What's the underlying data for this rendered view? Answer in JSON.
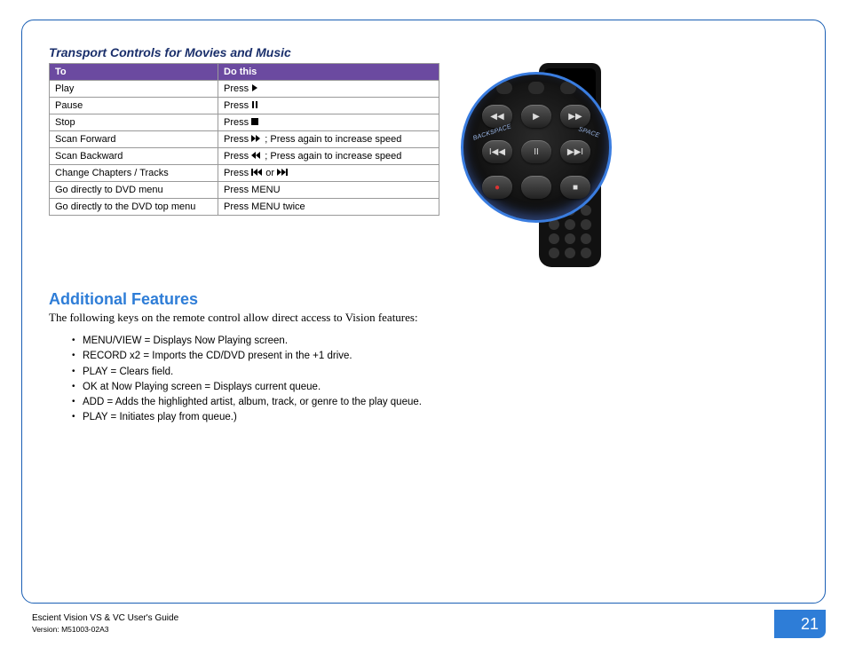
{
  "section_title": "Transport Controls for Movies and Music",
  "table": {
    "headers": {
      "to": "To",
      "do": "Do this"
    },
    "rows": [
      {
        "to": "Play",
        "do_pre": "Press ",
        "icon": "play",
        "do_post": ""
      },
      {
        "to": "Pause",
        "do_pre": "Press ",
        "icon": "pause",
        "do_post": ""
      },
      {
        "to": "Stop",
        "do_pre": "Press ",
        "icon": "stop",
        "do_post": ""
      },
      {
        "to": "Scan Forward",
        "do_pre": "Press ",
        "icon": "ff",
        "do_post": " ; Press again to increase speed"
      },
      {
        "to": "Scan Backward",
        "do_pre": "Press ",
        "icon": "rw",
        "do_post": " ; Press again to increase speed"
      },
      {
        "to": "Change Chapters / Tracks",
        "do_pre": "Press ",
        "icon": "skipb",
        "do_mid": "  or ",
        "icon2": "skipf",
        "do_post": ""
      },
      {
        "to": "Go directly to DVD menu",
        "do_pre": "Press MENU",
        "icon": "",
        "do_post": ""
      },
      {
        "to": "Go directly to the DVD top menu",
        "do_pre": "Press MENU twice",
        "icon": "",
        "do_post": ""
      }
    ]
  },
  "remote_labels": {
    "backspace": "BACKSPACE",
    "space": "SPACE"
  },
  "additional": {
    "heading": "Additional Features",
    "intro": "The following keys on the remote control allow direct access to Vision features:",
    "items": [
      "MENU/VIEW = Displays Now Playing screen.",
      "RECORD x2 = Imports the CD/DVD present in the +1 drive.",
      "PLAY = Clears field.",
      "OK at Now Playing screen = Displays current queue.",
      "ADD = Adds the highlighted artist, album, track, or genre to the play queue.",
      "PLAY = Initiates play from queue.)"
    ]
  },
  "footer": {
    "guide": "Escient Vision VS & VC User's Guide",
    "version": "Version: M51003-02A3",
    "page": "21"
  }
}
